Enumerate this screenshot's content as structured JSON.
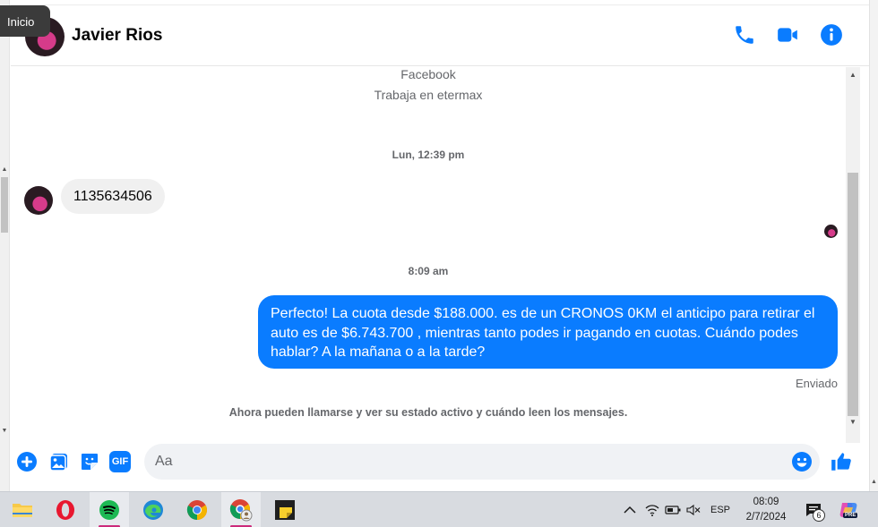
{
  "tooltip": {
    "text": "Inicio"
  },
  "header": {
    "contact_name": "Javier Rios",
    "icons": [
      "phone-icon",
      "video-call-icon",
      "info-icon"
    ],
    "accent_color": "#0a7cff"
  },
  "chat": {
    "profile_lines": [
      "Facebook",
      "Trabaja en etermax"
    ],
    "timestamp_1": "Lun, 12:39 pm",
    "incoming_message": "1135634506",
    "timestamp_2": "8:09 am",
    "outgoing_message": "Perfecto! La cuota desde $188.000. es de un CRONOS 0KM el anticipo para retirar el auto es de $6.743.700 , mientras tanto podes ir pagando en cuotas. Cuándo podes hablar? A la mañana o a la tarde?",
    "status": "Enviado",
    "notice": "Ahora pueden llamarse y ver su estado activo y cuándo leen los mensajes."
  },
  "composer": {
    "placeholder": "Aa",
    "icons": [
      "add-icon",
      "image-icon",
      "sticker-icon",
      "gif-icon",
      "emoji-icon",
      "like-icon"
    ],
    "gif_label": "GIF"
  },
  "taskbar": {
    "apps": [
      "file-explorer-icon",
      "opera-icon",
      "spotify-icon",
      "edge-icon",
      "chrome-icon",
      "chrome-profile-icon",
      "sticky-notes-icon"
    ],
    "language": "ESP",
    "time": "08:09",
    "date": "2/7/2024",
    "notification_count": "6",
    "copilot_badge": "PRE"
  }
}
